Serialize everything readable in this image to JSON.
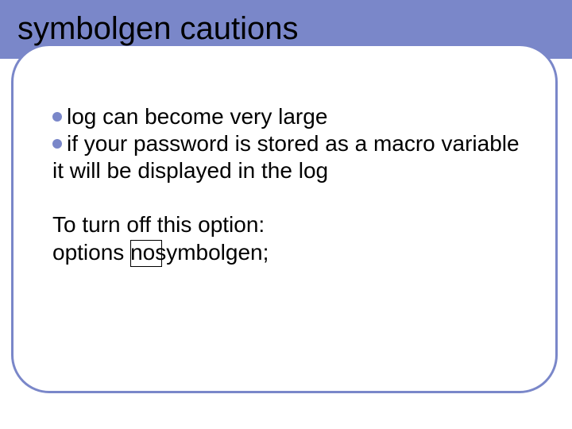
{
  "title": "symbolgen cautions",
  "bullets": [
    "log can become very large",
    "if your password is stored as a macro variable it will be displayed in the log"
  ],
  "turn_off_heading": "To turn off this option:",
  "option_line": "options nosymbolgen;",
  "colors": {
    "band": "#7a87c9",
    "bullet": "#7a87c9"
  }
}
